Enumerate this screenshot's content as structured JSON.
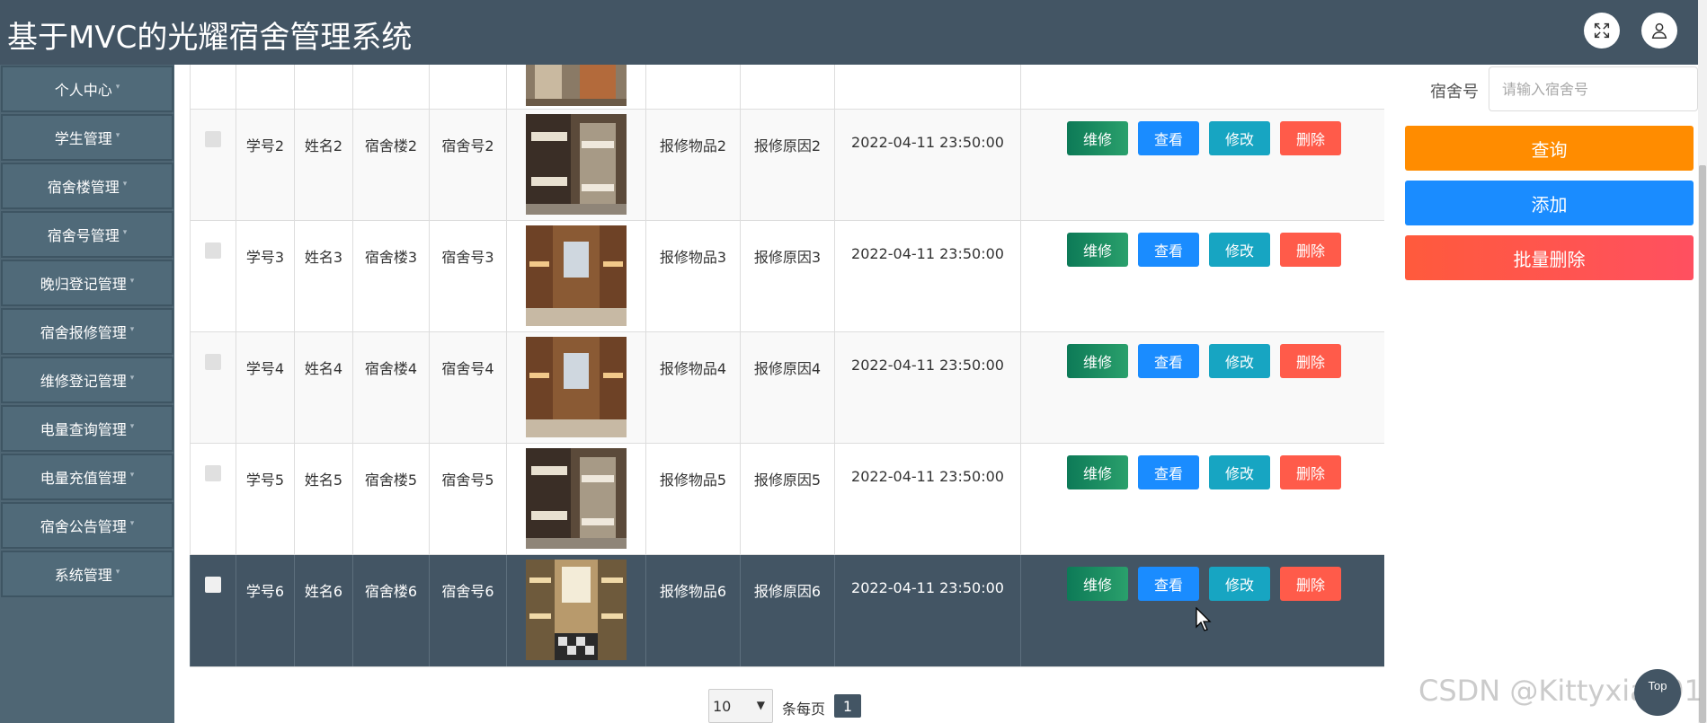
{
  "header": {
    "title": "基于MVC的光耀宿舍管理系统"
  },
  "sidebar": {
    "items": [
      {
        "label": "个人中心"
      },
      {
        "label": "学生管理"
      },
      {
        "label": "宿舍楼管理"
      },
      {
        "label": "宿舍号管理"
      },
      {
        "label": "晚归登记管理"
      },
      {
        "label": "宿舍报修管理"
      },
      {
        "label": "维修登记管理"
      },
      {
        "label": "电量查询管理"
      },
      {
        "label": "电量充值管理"
      },
      {
        "label": "宿舍公告管理"
      },
      {
        "label": "系统管理"
      }
    ]
  },
  "actions": {
    "repair": "维修",
    "view": "查看",
    "edit": "修改",
    "delete": "删除"
  },
  "table": {
    "rows": [
      {
        "student_id": "学号2",
        "name": "姓名2",
        "building": "宿舍楼2",
        "room": "宿舍号2",
        "item": "报修物品2",
        "reason": "报修原因2",
        "time": "2022-04-11 23:50:00"
      },
      {
        "student_id": "学号3",
        "name": "姓名3",
        "building": "宿舍楼3",
        "room": "宿舍号3",
        "item": "报修物品3",
        "reason": "报修原因3",
        "time": "2022-04-11 23:50:00"
      },
      {
        "student_id": "学号4",
        "name": "姓名4",
        "building": "宿舍楼4",
        "room": "宿舍号4",
        "item": "报修物品4",
        "reason": "报修原因4",
        "time": "2022-04-11 23:50:00"
      },
      {
        "student_id": "学号5",
        "name": "姓名5",
        "building": "宿舍楼5",
        "room": "宿舍号5",
        "item": "报修物品5",
        "reason": "报修原因5",
        "time": "2022-04-11 23:50:00"
      },
      {
        "student_id": "学号6",
        "name": "姓名6",
        "building": "宿舍楼6",
        "room": "宿舍号6",
        "item": "报修物品6",
        "reason": "报修原因6",
        "time": "2022-04-11 23:50:00"
      }
    ]
  },
  "search": {
    "label": "宿舍号",
    "placeholder": "请输入宿舍号"
  },
  "buttons": {
    "query": "查询",
    "add": "添加",
    "batch_delete": "批量删除"
  },
  "pagination": {
    "page_size": "10",
    "per_page_label": "条每页",
    "current_page": "1"
  },
  "watermark": "CSDN @Kittyxia001",
  "top_button": "Top",
  "colors": {
    "header": "#435564",
    "sidebar": "#4f6674",
    "query": "#ff8c00",
    "add": "#1a8cff",
    "delete": "#ff5b4a"
  }
}
